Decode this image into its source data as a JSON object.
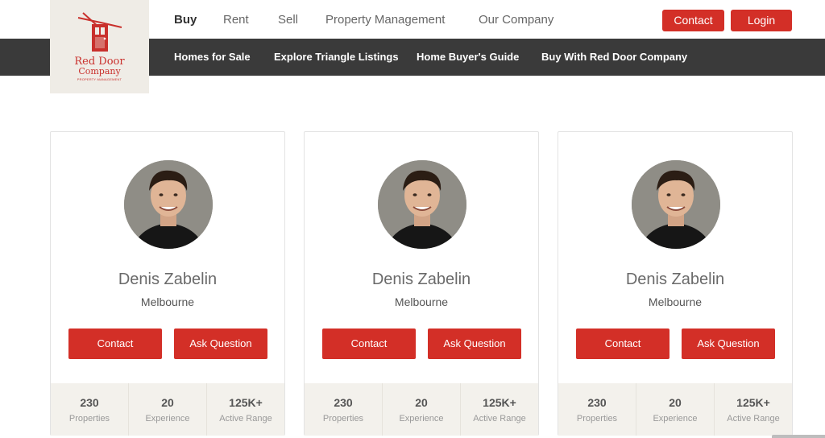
{
  "brand": {
    "line1": "Red Door",
    "line2": "Company",
    "line3": "PROPERTY MANAGEMENT",
    "color": "#c9302c"
  },
  "main_nav": [
    "Buy",
    "Rent",
    "Sell",
    "Property Management",
    "Our Company"
  ],
  "header_buttons": {
    "contact": "Contact",
    "login": "Login"
  },
  "sub_nav": [
    "Homes for Sale",
    "Explore Triangle Listings",
    "Home Buyer's Guide",
    "Buy With Red Door Company"
  ],
  "agents": [
    {
      "name": "Denis Zabelin",
      "city": "Melbourne",
      "contact_label": "Contact",
      "ask_label": "Ask Question",
      "stats": [
        {
          "value": "230",
          "label": "Properties"
        },
        {
          "value": "20",
          "label": "Experience"
        },
        {
          "value": "125K+",
          "label": "Active Range"
        }
      ]
    },
    {
      "name": "Denis Zabelin",
      "city": "Melbourne",
      "contact_label": "Contact",
      "ask_label": "Ask Question",
      "stats": [
        {
          "value": "230",
          "label": "Properties"
        },
        {
          "value": "20",
          "label": "Experience"
        },
        {
          "value": "125K+",
          "label": "Active Range"
        }
      ]
    },
    {
      "name": "Denis Zabelin",
      "city": "Melbourne",
      "contact_label": "Contact",
      "ask_label": "Ask Question",
      "stats": [
        {
          "value": "230",
          "label": "Properties"
        },
        {
          "value": "20",
          "label": "Experience"
        },
        {
          "value": "125K+",
          "label": "Active Range"
        }
      ]
    }
  ],
  "colors": {
    "accent": "#d32f27",
    "nav_bg": "#3a3a3a",
    "logo_bg": "#efece6"
  }
}
